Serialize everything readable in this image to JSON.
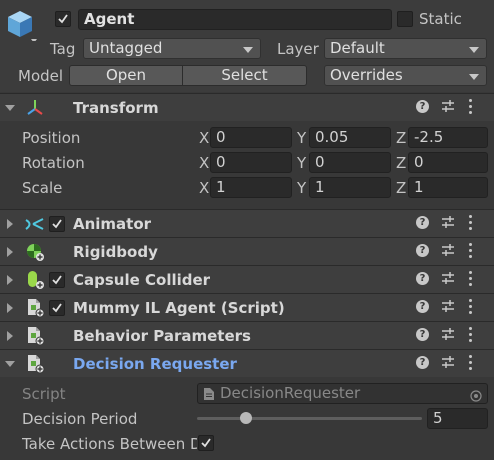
{
  "gameobject": {
    "name": "Agent",
    "active_checked": true,
    "static_label": "Static",
    "static_checked": false,
    "tag_label": "Tag",
    "tag_value": "Untagged",
    "layer_label": "Layer",
    "layer_value": "Default",
    "model_label": "Model",
    "open_label": "Open",
    "select_label": "Select",
    "overrides_label": "Overrides"
  },
  "transform": {
    "title": "Transform",
    "position_label": "Position",
    "rotation_label": "Rotation",
    "scale_label": "Scale",
    "x_axis": "X",
    "y_axis": "Y",
    "z_axis": "Z",
    "position": {
      "x": "0",
      "y": "0.05",
      "z": "-2.5"
    },
    "rotation": {
      "x": "0",
      "y": "0",
      "z": "0"
    },
    "scale": {
      "x": "1",
      "y": "1",
      "z": "1"
    }
  },
  "components": [
    {
      "title": "Animator",
      "enabled": true,
      "icon": "animator-icon"
    },
    {
      "title": "Rigidbody",
      "enabled": null,
      "icon": "rigidbody-icon"
    },
    {
      "title": "Capsule Collider",
      "enabled": true,
      "icon": "capsule-collider-icon"
    },
    {
      "title": "Mummy IL Agent (Script)",
      "enabled": true,
      "icon": "script-icon"
    },
    {
      "title": "Behavior Parameters",
      "enabled": null,
      "icon": "script-icon"
    },
    {
      "title": "Decision Requester",
      "enabled": null,
      "icon": "script-icon"
    }
  ],
  "decision_requester": {
    "script_label": "Script",
    "script_value": "DecisionRequester",
    "decision_period_label": "Decision Period",
    "decision_period_value": "5",
    "decision_period_fraction": 0.2,
    "take_actions_label": "Take Actions Between D",
    "take_actions_checked": true
  },
  "colors": {
    "background": "#383838",
    "header": "#3e3e3e",
    "field": "#2a2a2a",
    "accent_title": "#7aa8f0"
  }
}
